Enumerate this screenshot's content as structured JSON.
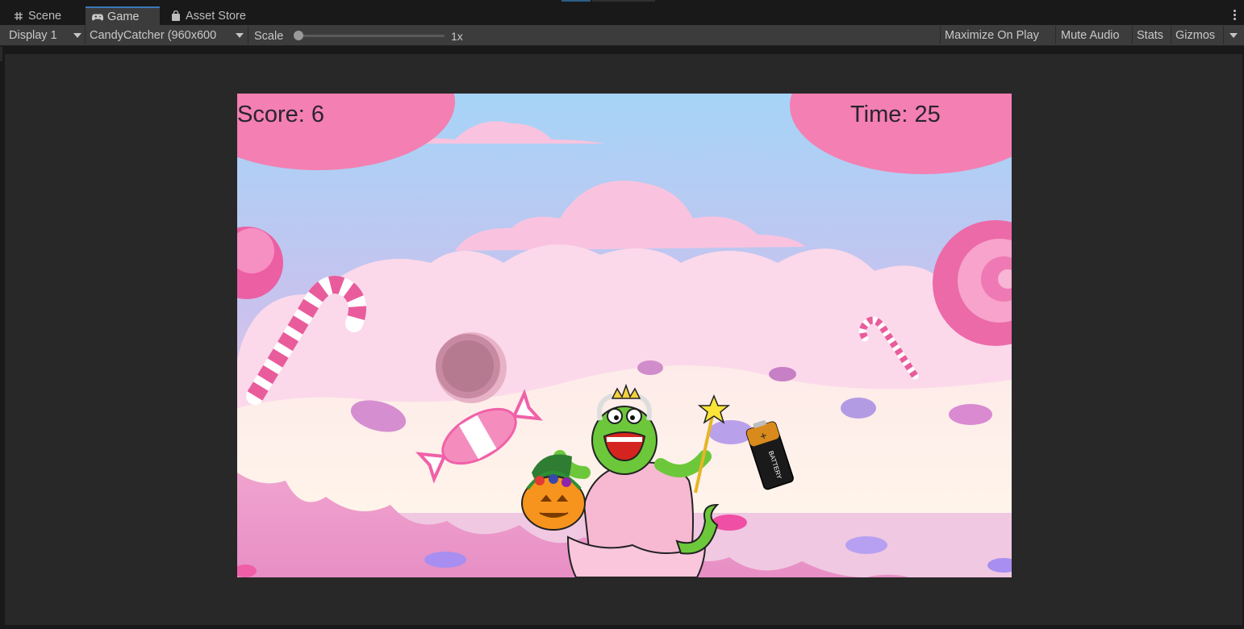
{
  "tabs": [
    {
      "label": "Scene",
      "icon": "grid-icon"
    },
    {
      "label": "Game",
      "icon": "gamepad-icon"
    },
    {
      "label": "Asset Store",
      "icon": "shopping-bag-icon"
    }
  ],
  "toolbar": {
    "display": "Display 1",
    "resolution": "CandyCatcher (960x600",
    "scale_label": "Scale",
    "scale_value": "1x",
    "scale_level": 0,
    "maximize": "Maximize On Play",
    "mute": "Mute Audio",
    "stats": "Stats",
    "gizmos": "Gizmos"
  },
  "game": {
    "score": "Score: 6",
    "time": "Time: 25",
    "battery_text": "BATTERY",
    "battery_plus": "+"
  },
  "colors": {
    "editor_bg": "#282828",
    "toolbar_bg": "#3c3c3c",
    "active_tab_accent": "#3a79bb",
    "sky_top": "#a9d2f5",
    "candy_pink": "#f47fb2",
    "monster_green": "#6cc83a"
  }
}
